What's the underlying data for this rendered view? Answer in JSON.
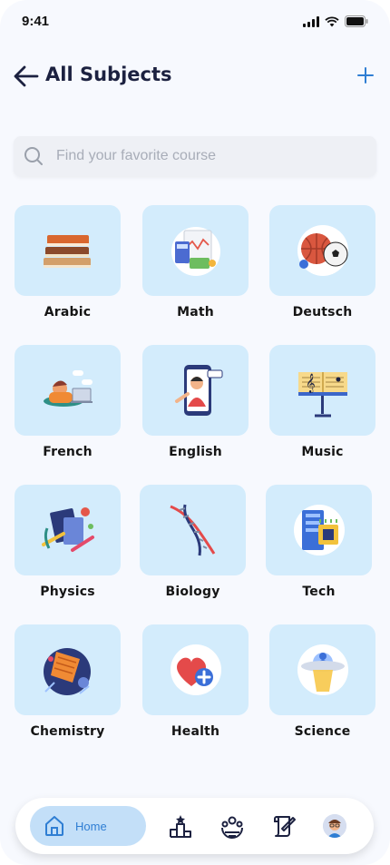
{
  "status_bar": {
    "time": "9:41"
  },
  "header": {
    "title": "All Subjects"
  },
  "search": {
    "placeholder": "Find your favorite course"
  },
  "subjects": [
    {
      "label": "Arabic",
      "icon": "books-icon"
    },
    {
      "label": "Math",
      "icon": "calculator-icon"
    },
    {
      "label": "Deutsch",
      "icon": "sports-balls-icon"
    },
    {
      "label": "French",
      "icon": "student-laptop-icon"
    },
    {
      "label": "English",
      "icon": "teacher-phone-icon"
    },
    {
      "label": "Music",
      "icon": "music-stand-icon"
    },
    {
      "label": "Physics",
      "icon": "science-stationery-icon"
    },
    {
      "label": "Biology",
      "icon": "dna-icon"
    },
    {
      "label": "Tech",
      "icon": "server-chip-icon"
    },
    {
      "label": "Chemistry",
      "icon": "chemistry-lab-icon"
    },
    {
      "label": "Health",
      "icon": "heart-plus-icon"
    },
    {
      "label": "Science",
      "icon": "ufo-icon"
    }
  ],
  "bottom_nav": {
    "home_label": "Home",
    "items": [
      "home-icon",
      "leaderboard-icon",
      "community-icon",
      "certificate-icon",
      "profile-avatar"
    ]
  },
  "colors": {
    "tile": "#d3ecfc",
    "accent": "#2f7ed3",
    "title": "#1c2140"
  }
}
